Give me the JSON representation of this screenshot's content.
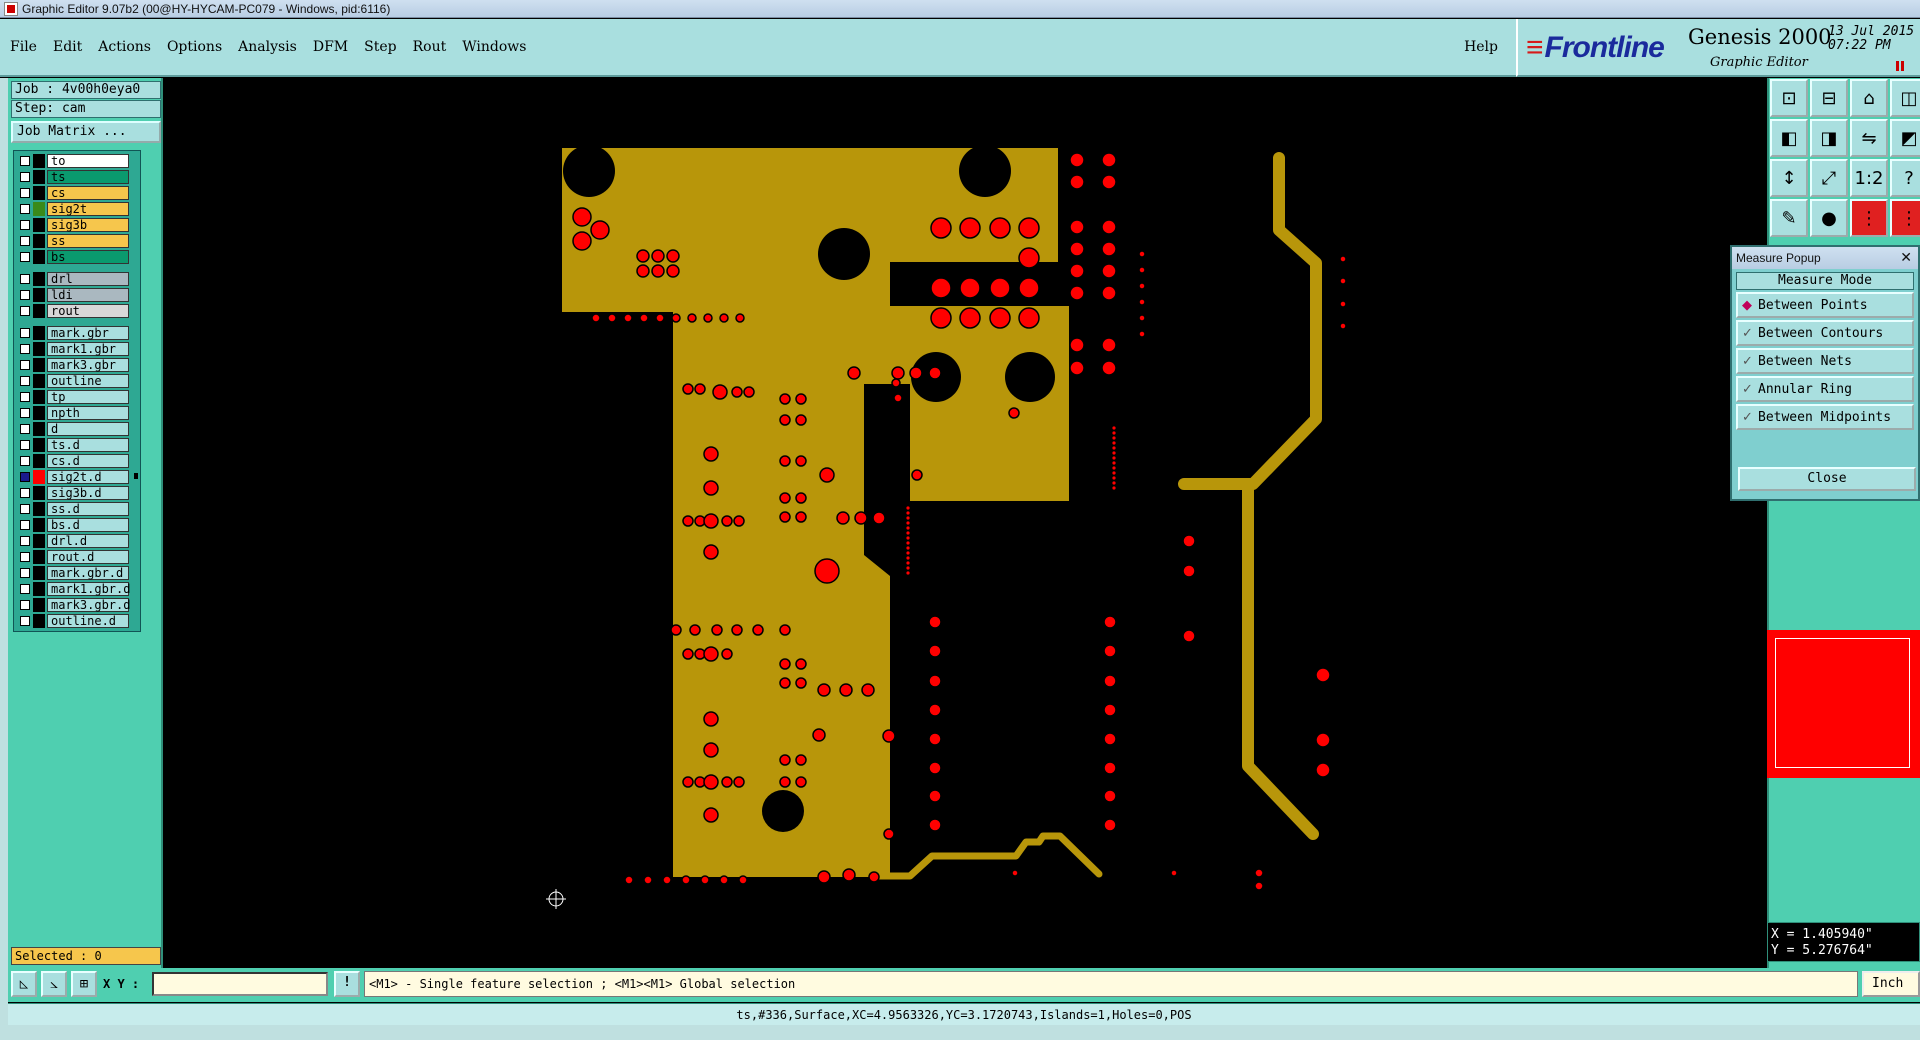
{
  "window": {
    "title": "Graphic Editor 9.07b2 (00@HY-HYCAM-PC079 - Windows, pid:6116)"
  },
  "menu": [
    "File",
    "Edit",
    "Actions",
    "Options",
    "Analysis",
    "DFM",
    "Step",
    "Rout",
    "Windows"
  ],
  "help_label": "Help",
  "brand": {
    "logo": "Frontline",
    "product": "Genesis 2000",
    "subtitle": "Graphic Editor",
    "date": "13 Jul 2015",
    "time": "07:22 PM"
  },
  "job": {
    "job_label": "Job : 4v00h0eya0",
    "step_label": "Step: cam",
    "matrix_button": "Job Matrix ..."
  },
  "layers": [
    {
      "name": "to",
      "color": "#ffffff",
      "swatch": "#000000",
      "checked": false
    },
    {
      "name": "ts",
      "color": "#0a9a6e",
      "swatch": "#000000",
      "checked": false
    },
    {
      "name": "cs",
      "color": "#f6c64c",
      "swatch": "#000000",
      "checked": false
    },
    {
      "name": "sig2t",
      "color": "#f6c64c",
      "swatch": "#3a8a1a",
      "checked": false
    },
    {
      "name": "sig3b",
      "color": "#f6c64c",
      "swatch": "#000000",
      "checked": false
    },
    {
      "name": "ss",
      "color": "#f6c64c",
      "swatch": "#000000",
      "checked": false
    },
    {
      "name": "bs",
      "color": "#0a9a6e",
      "swatch": "#000000",
      "checked": false
    },
    {
      "gap": true
    },
    {
      "name": "drl",
      "color": "#aab8c0",
      "swatch": "#000000",
      "checked": false
    },
    {
      "name": "ldi",
      "color": "#aab8c0",
      "swatch": "#000000",
      "checked": false
    },
    {
      "name": "rout",
      "color": "#d8d8d8",
      "swatch": "#000000",
      "checked": false
    },
    {
      "gap": true
    },
    {
      "name": "mark.gbr",
      "color": "#a9dfdf",
      "swatch": "#000000",
      "checked": false
    },
    {
      "name": "mark1.gbr",
      "color": "#a9dfdf",
      "swatch": "#000000",
      "checked": false
    },
    {
      "name": "mark3.gbr",
      "color": "#a9dfdf",
      "swatch": "#000000",
      "checked": false
    },
    {
      "name": "outline",
      "color": "#a9dfdf",
      "swatch": "#000000",
      "checked": false
    },
    {
      "name": "tp",
      "color": "#a9dfdf",
      "swatch": "#000000",
      "checked": false
    },
    {
      "name": "npth",
      "color": "#a9dfdf",
      "swatch": "#000000",
      "checked": false
    },
    {
      "name": "d",
      "color": "#a9dfdf",
      "swatch": "#000000",
      "checked": false
    },
    {
      "name": "ts.d",
      "color": "#a9dfdf",
      "swatch": "#000000",
      "checked": false
    },
    {
      "name": "cs.d",
      "color": "#a9dfdf",
      "swatch": "#000000",
      "checked": false
    },
    {
      "name": "sig2t.d",
      "color": "#a9dfdf",
      "swatch": "#ff0000",
      "checked": true,
      "marker": true
    },
    {
      "name": "sig3b.d",
      "color": "#a9dfdf",
      "swatch": "#000000",
      "checked": false
    },
    {
      "name": "ss.d",
      "color": "#a9dfdf",
      "swatch": "#000000",
      "checked": false
    },
    {
      "name": "bs.d",
      "color": "#a9dfdf",
      "swatch": "#000000",
      "checked": false
    },
    {
      "name": "drl.d",
      "color": "#a9dfdf",
      "swatch": "#000000",
      "checked": false
    },
    {
      "name": "rout.d",
      "color": "#a9dfdf",
      "swatch": "#000000",
      "checked": false
    },
    {
      "name": "mark.gbr.d",
      "color": "#a9dfdf",
      "swatch": "#000000",
      "checked": false
    },
    {
      "name": "mark1.gbr.d",
      "color": "#a9dfdf",
      "swatch": "#000000",
      "checked": false
    },
    {
      "name": "mark3.gbr.d",
      "color": "#a9dfdf",
      "swatch": "#000000",
      "checked": false
    },
    {
      "name": "outline.d",
      "color": "#a9dfdf",
      "swatch": "#000000",
      "checked": false
    }
  ],
  "selected_label": "Selected : 0",
  "toolbar": [
    {
      "icon": "zoom-in-box-icon",
      "glyph": "⊡"
    },
    {
      "icon": "zoom-out-box-icon",
      "glyph": "⊟"
    },
    {
      "icon": "home-icon",
      "glyph": "⌂"
    },
    {
      "icon": "window-split-icon",
      "glyph": "◫"
    },
    {
      "icon": "pan-left-icon",
      "glyph": "◧"
    },
    {
      "icon": "pan-right-icon",
      "glyph": "◨"
    },
    {
      "icon": "toggle-icon",
      "glyph": "⇋"
    },
    {
      "icon": "layers-icon",
      "glyph": "◩"
    },
    {
      "icon": "fit-vertical-icon",
      "glyph": "↕"
    },
    {
      "icon": "fit-all-icon",
      "glyph": "⤢"
    },
    {
      "icon": "scale-1-2-icon",
      "glyph": "1:2"
    },
    {
      "icon": "help-query-icon",
      "glyph": "?"
    },
    {
      "icon": "snap-icon",
      "glyph": "✎"
    },
    {
      "icon": "drill-pin-icon",
      "glyph": "●"
    },
    {
      "icon": "net-highlight-icon",
      "glyph": "⋮"
    },
    {
      "icon": "net-highlight-2-icon",
      "glyph": "⋮"
    }
  ],
  "measure": {
    "title": "Measure Popup",
    "mode_label": "Measure Mode",
    "options": [
      "Between Points",
      "Between Contours",
      "Between Nets",
      "Annular Ring",
      "Between Midpoints"
    ],
    "selected_option": "Between Points",
    "close_label": "Close"
  },
  "coords": {
    "x": "X = 1.405940\"",
    "y": "Y = 5.276764\""
  },
  "bottom": {
    "xy_label": "X Y :",
    "xy_value": "",
    "hint": "<M1> - Single feature selection ; <M1><M1> Global selection",
    "unit": "Inch"
  },
  "status": "ts,#336,Surface,XC=4.9563326,YC=3.1720743,Islands=1,Holes=0,POS",
  "colors": {
    "copper": "#b8960a",
    "pad": "#ff0000",
    "background": "#000000",
    "panel": "#4fcfb0",
    "menubar": "#a9dfdf"
  }
}
